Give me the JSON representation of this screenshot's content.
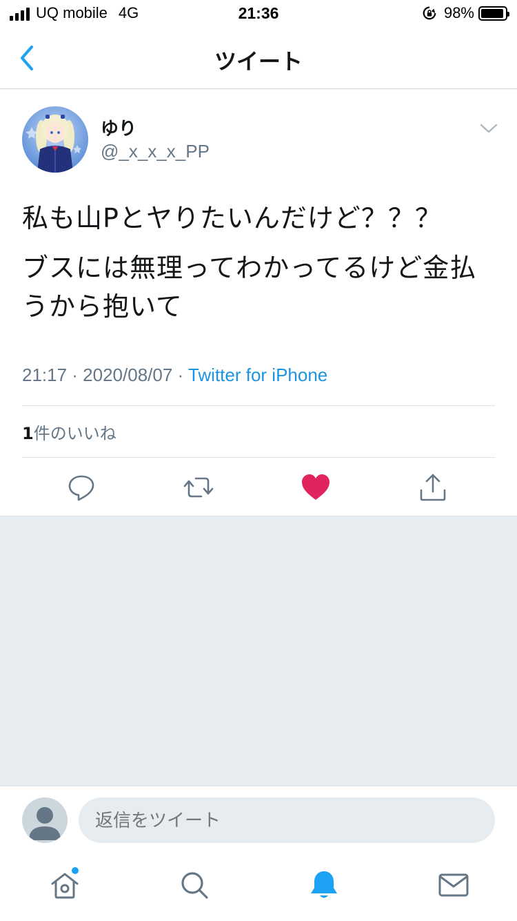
{
  "status_bar": {
    "carrier": "UQ mobile",
    "network": "4G",
    "time": "21:36",
    "battery_percent": "98%"
  },
  "nav": {
    "title": "ツイート",
    "back_icon": "chevron-left-icon"
  },
  "tweet": {
    "display_name": "ゆり",
    "handle": "@_x_x_x_PP",
    "text_line1": "私も山Pとヤりたいんだけど？？？",
    "text_line2": "ブスには無理ってわかってるけど金払うから抱いて",
    "timestamp": "21:17 · 2020/08/07 · ",
    "source": "Twitter for iPhone",
    "likes_count": "1",
    "likes_label": "件のいいね",
    "liked": true
  },
  "colors": {
    "accent": "#1da1f2",
    "link": "#1b95e0",
    "like_red": "#e0245e",
    "secondary_text": "#657786",
    "background_gray": "#e6ecf0"
  },
  "reply": {
    "placeholder": "返信をツイート"
  },
  "tab_bar": {
    "items": [
      "home-icon",
      "search-icon",
      "notifications-icon",
      "messages-icon"
    ],
    "active": "notifications-icon",
    "home_has_unread": true
  }
}
